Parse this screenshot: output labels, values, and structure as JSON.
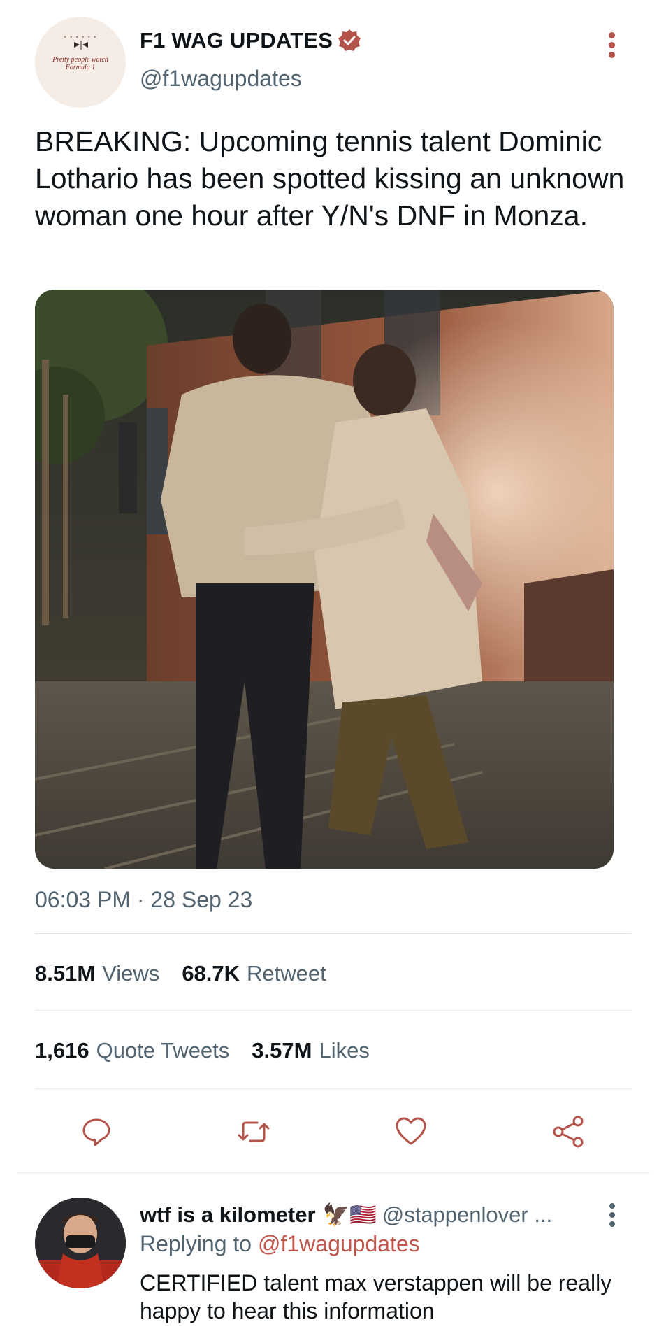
{
  "author": {
    "display_name": "F1 WAG UPDATES",
    "handle": "@f1wagupdates",
    "avatar_logo_text_1": "Pretty people watch",
    "avatar_logo_text_2": "Formula 1",
    "verified_icon": "verified-badge-icon"
  },
  "tweet": {
    "text": "BREAKING: Upcoming tennis talent Dominic Lothario has been spotted kissing an unknown woman one hour after Y/N's DNF in Monza.",
    "timestamp": "06:03 PM · 28 Sep 23"
  },
  "stats": {
    "views_count": "8.51M",
    "views_label": "Views",
    "retweets_count": "68.7K",
    "retweets_label": "Retweet",
    "quotes_count": "1,616",
    "quotes_label": "Quote Tweets",
    "likes_count": "3.57M",
    "likes_label": "Likes"
  },
  "actions": {
    "reply_icon": "reply-icon",
    "retweet_icon": "retweet-icon",
    "like_icon": "heart-icon",
    "share_icon": "share-icon"
  },
  "reply": {
    "display_name": "wtf is a kilometer",
    "emoji": "🦅🇺🇸",
    "handle": "@stappenlover ...",
    "replying_prefix": "Replying to",
    "replying_to": "@f1wagupdates",
    "text": "CERTIFIED talent max verstappen will be really happy to hear this information"
  },
  "colors": {
    "accent": "#c0564c",
    "secondary_text": "#536471",
    "divider": "#e3e6e8"
  }
}
